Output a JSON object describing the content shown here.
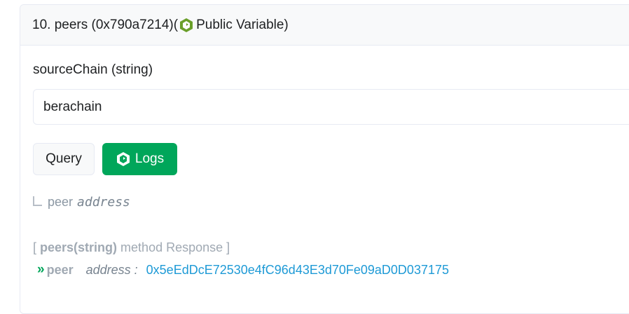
{
  "header": {
    "prefix": "10. peers (0x790a7214)(",
    "suffix": "Public Variable)"
  },
  "field": {
    "label": "sourceChain (string)",
    "value": "berachain"
  },
  "buttons": {
    "query": "Query",
    "logs": "Logs"
  },
  "output": {
    "name": "peer",
    "type": "address"
  },
  "response": {
    "open": "[ ",
    "method": "peers(string)",
    "rest": " method Response ]",
    "chevron": "»",
    "name": "peer",
    "type": "address :",
    "value": "0x5eEdDcE72530e4fC96d43E3d70Fe09aD0D037175"
  },
  "colors": {
    "accent_green": "#00a65a",
    "link_blue": "#1e9ad6",
    "icon_green": "#6a9f2a"
  }
}
